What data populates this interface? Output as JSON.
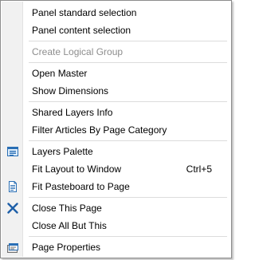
{
  "menu": {
    "items": [
      {
        "label": "Panel standard selection"
      },
      {
        "label": "Panel content selection"
      },
      {
        "label": "Create Logical Group",
        "disabled": true
      },
      {
        "label": "Open Master"
      },
      {
        "label": "Show Dimensions"
      },
      {
        "label": "Shared Layers Info"
      },
      {
        "label": "Filter Articles By Page Category"
      },
      {
        "label": "Layers Palette",
        "icon": "layers-palette-icon"
      },
      {
        "label": "Fit Layout to Window",
        "shortcut": "Ctrl+5"
      },
      {
        "label": "Fit Pasteboard to Page",
        "icon": "page-icon"
      },
      {
        "label": "Close This Page",
        "icon": "close-x-icon"
      },
      {
        "label": "Close All But This"
      },
      {
        "label": "Page Properties",
        "icon": "page-properties-icon"
      }
    ]
  },
  "colors": {
    "menu_border": "#8c8c8c",
    "gutter": "#f1f1f1",
    "separator": "#dcdcdc",
    "disabled_text": "#8d8d8d",
    "icon_blue": "#2a6fb5",
    "close_icon_blue": "#1e5fa8"
  }
}
